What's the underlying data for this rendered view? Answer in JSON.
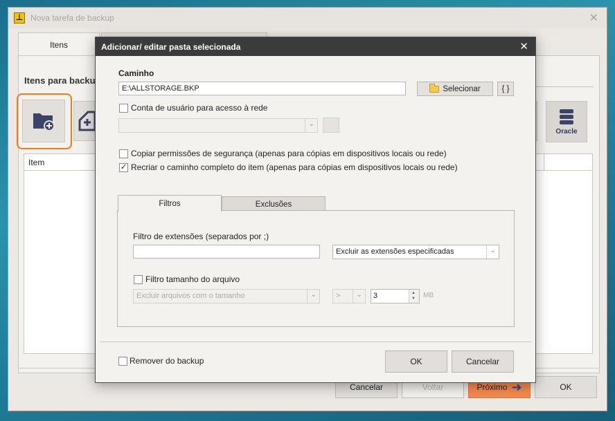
{
  "parent": {
    "app_icon_glyph": "⊥",
    "title": "Nova tarefa de backup",
    "close_glyph": "✕",
    "tab_label": "Itens",
    "section_title": "Itens para backup",
    "oracle_label": "Oracle",
    "list_header_item": "Item",
    "buttons": {
      "cancelar": "Cancelar",
      "voltar": "Voltar",
      "proximo": "Próximo",
      "proximo_arrow": "➜",
      "ok": "OK"
    },
    "colors": {
      "proximo_bg": "#f58a4c",
      "highlight_border": "#f07a22"
    }
  },
  "dialog": {
    "title": "Adicionar/ editar pasta selecionada",
    "close_glyph": "✕",
    "caminho_label": "Caminho",
    "caminho_value": "E:\\ALLSTORAGE.BKP",
    "selecionar_label": "Selecionar",
    "variables_label": "{ }",
    "conta_label": "Conta de usuário para acesso à rede",
    "conta_checked": false,
    "conta_select_value": "",
    "copiar_label": "Copiar permissões de segurança (apenas para cópias em dispositivos locais ou rede)",
    "copiar_checked": false,
    "recriar_label": "Recriar o caminho completo do item (apenas para cópias em dispositivos locais ou rede)",
    "recriar_checked": true,
    "check_glyph": "✓",
    "tabs": {
      "filtros": "Filtros",
      "exclusoes": "Exclusões"
    },
    "filtro_ext_label": "Filtro de extensões (separados por ;)",
    "filtro_ext_value": "",
    "ext_mode_value": "Excluir as extensões especificadas",
    "filtro_tam_label": "Filtro tamanho do arquivo",
    "filtro_tam_checked": false,
    "tam_mode_value": "Excluir arquivos com o tamanho",
    "comparator_value": ">",
    "size_value": "3",
    "size_unit": "MB",
    "remover_label": "Remover do backup",
    "remover_checked": false,
    "ok_label": "OK",
    "cancelar_label": "Cancelar"
  }
}
